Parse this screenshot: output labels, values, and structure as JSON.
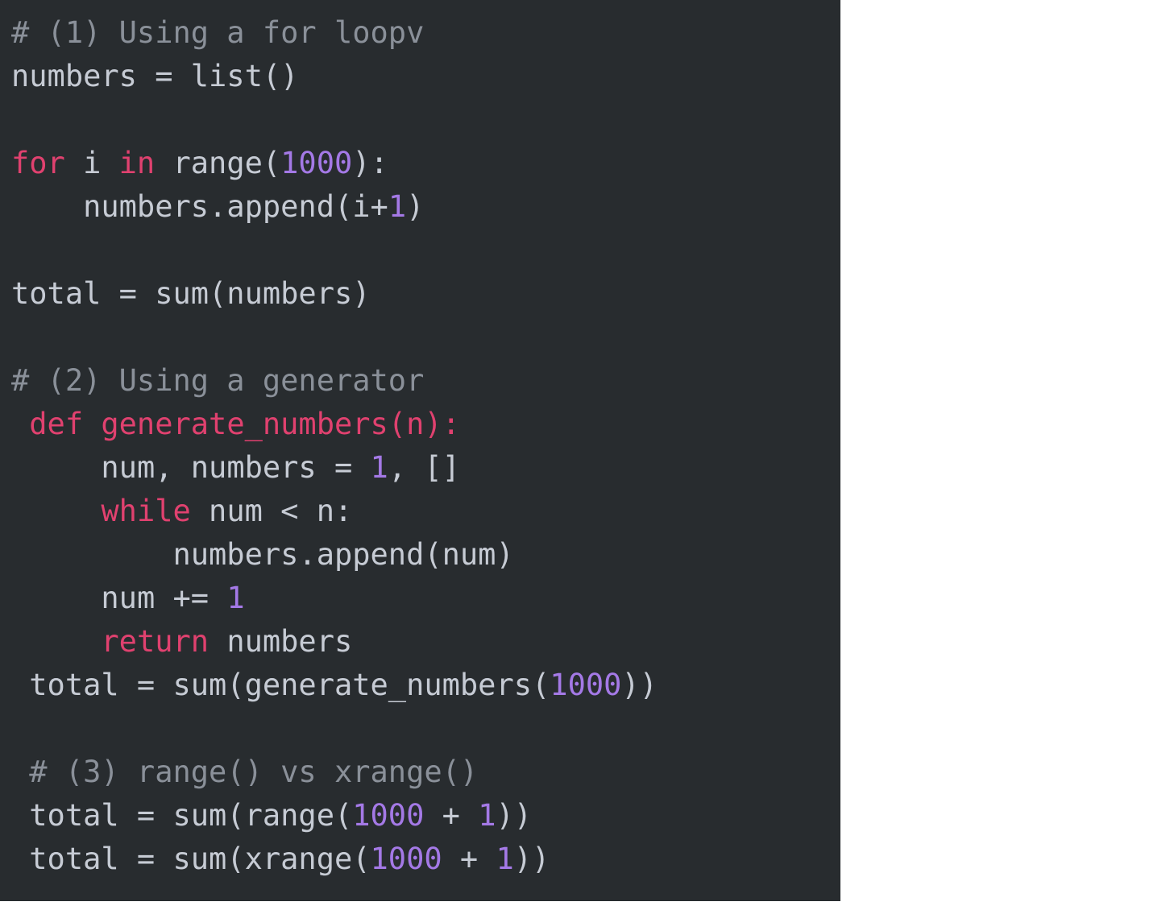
{
  "panel": {
    "background_color": "#282c2f",
    "page_background_color": "#ffffff",
    "language": "python"
  },
  "theme": {
    "plain_color": "#c6cbd4",
    "comment_color": "#8a9099",
    "keyword_color": "#e0416f",
    "number_color": "#a479e6",
    "function_def_color": "#e0416f"
  },
  "code": {
    "full_text": "# (1) Using a for loopv\nnumbers = list()\n\nfor i in range(1000):\n    numbers.append(i+1)\n\ntotal = sum(numbers)\n\n# (2) Using a generator\n def generate_numbers(n):\n     num, numbers = 1, []\n     while num < n:\n         numbers.append(num)\n     num += 1\n     return numbers\n total = sum(generate_numbers(1000))\n\n # (3) range() vs xrange()\n total = sum(range(1000 + 1))\n total = sum(xrange(1000 + 1))",
    "lines": [
      {
        "index": 1,
        "indent": "",
        "tokens": [
          {
            "text": "# (1) Using a for loopv",
            "type": "comment"
          }
        ]
      },
      {
        "index": 2,
        "indent": "",
        "tokens": [
          {
            "text": "numbers = list()",
            "type": "plain"
          }
        ]
      },
      {
        "index": 3,
        "indent": "",
        "blank": true,
        "tokens": []
      },
      {
        "index": 4,
        "indent": "",
        "tokens": [
          {
            "text": "for",
            "type": "keyword"
          },
          {
            "text": " i ",
            "type": "plain"
          },
          {
            "text": "in",
            "type": "keyword"
          },
          {
            "text": " range(",
            "type": "plain"
          },
          {
            "text": "1000",
            "type": "number"
          },
          {
            "text": "):",
            "type": "plain"
          }
        ]
      },
      {
        "index": 5,
        "indent": "    ",
        "tokens": [
          {
            "text": "numbers.append(i+",
            "type": "plain"
          },
          {
            "text": "1",
            "type": "number"
          },
          {
            "text": ")",
            "type": "plain"
          }
        ]
      },
      {
        "index": 6,
        "indent": "",
        "blank": true,
        "tokens": []
      },
      {
        "index": 7,
        "indent": "",
        "tokens": [
          {
            "text": "total = sum(numbers)",
            "type": "plain"
          }
        ]
      },
      {
        "index": 8,
        "indent": "",
        "blank": true,
        "tokens": []
      },
      {
        "index": 9,
        "indent": "",
        "tokens": [
          {
            "text": "# (2) Using a generator",
            "type": "comment"
          }
        ]
      },
      {
        "index": 10,
        "indent": " ",
        "tokens": [
          {
            "text": "def generate_numbers(n):",
            "type": "defname"
          }
        ]
      },
      {
        "index": 11,
        "indent": "     ",
        "tokens": [
          {
            "text": "num, numbers = ",
            "type": "plain"
          },
          {
            "text": "1",
            "type": "number"
          },
          {
            "text": ", []",
            "type": "plain"
          }
        ]
      },
      {
        "index": 12,
        "indent": "     ",
        "tokens": [
          {
            "text": "while",
            "type": "keyword"
          },
          {
            "text": " num < n:",
            "type": "plain"
          }
        ]
      },
      {
        "index": 13,
        "indent": "         ",
        "tokens": [
          {
            "text": "numbers.append(num)",
            "type": "plain"
          }
        ]
      },
      {
        "index": 14,
        "indent": "     ",
        "tokens": [
          {
            "text": "num += ",
            "type": "plain"
          },
          {
            "text": "1",
            "type": "number"
          }
        ]
      },
      {
        "index": 15,
        "indent": "     ",
        "tokens": [
          {
            "text": "return",
            "type": "keyword"
          },
          {
            "text": " numbers",
            "type": "plain"
          }
        ]
      },
      {
        "index": 16,
        "indent": " ",
        "tokens": [
          {
            "text": "total = sum(generate_numbers(",
            "type": "plain"
          },
          {
            "text": "1000",
            "type": "number"
          },
          {
            "text": "))",
            "type": "plain"
          }
        ]
      },
      {
        "index": 17,
        "indent": "",
        "blank": true,
        "tokens": []
      },
      {
        "index": 18,
        "indent": " ",
        "tokens": [
          {
            "text": "# (3) range() vs xrange()",
            "type": "comment"
          }
        ]
      },
      {
        "index": 19,
        "indent": " ",
        "tokens": [
          {
            "text": "total = sum(range(",
            "type": "plain"
          },
          {
            "text": "1000",
            "type": "number"
          },
          {
            "text": " + ",
            "type": "plain"
          },
          {
            "text": "1",
            "type": "number"
          },
          {
            "text": "))",
            "type": "plain"
          }
        ]
      },
      {
        "index": 20,
        "indent": " ",
        "tokens": [
          {
            "text": "total = sum(xrange(",
            "type": "plain"
          },
          {
            "text": "1000",
            "type": "number"
          },
          {
            "text": " + ",
            "type": "plain"
          },
          {
            "text": "1",
            "type": "number"
          },
          {
            "text": "))",
            "type": "plain"
          }
        ]
      }
    ],
    "clipped_bottom_text": "total"
  }
}
